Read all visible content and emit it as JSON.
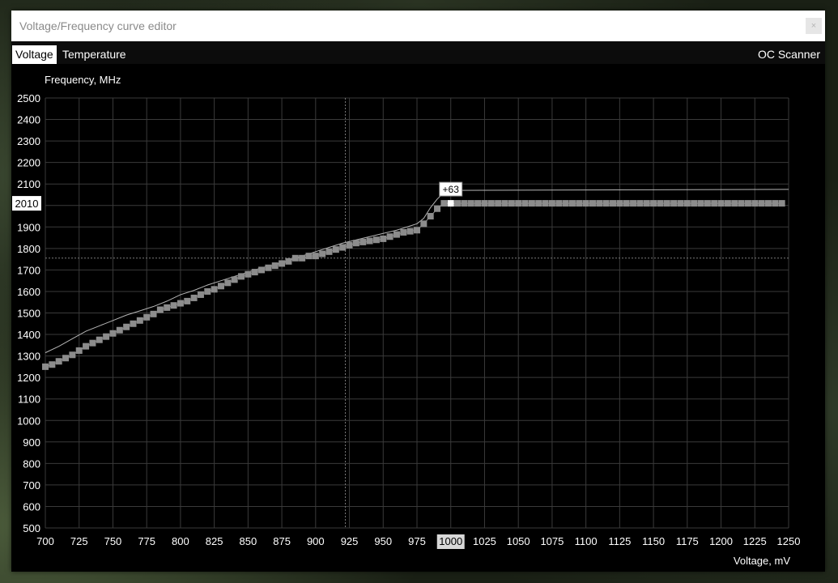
{
  "window": {
    "title": "Voltage/Frequency curve editor",
    "close_label": "×"
  },
  "tabs": [
    {
      "label": "Voltage",
      "active": true
    },
    {
      "label": "Temperature",
      "active": false
    }
  ],
  "oc_scanner_label": "OC Scanner",
  "chart_data": {
    "type": "line",
    "ylabel": "Frequency, MHz",
    "xlabel": "Voltage, mV",
    "xlim": [
      700,
      1250
    ],
    "ylim": [
      500,
      2500
    ],
    "x_ticks": [
      700,
      725,
      750,
      775,
      800,
      825,
      850,
      875,
      900,
      925,
      950,
      975,
      1000,
      1025,
      1050,
      1075,
      1100,
      1125,
      1150,
      1175,
      1200,
      1225,
      1250
    ],
    "y_ticks": [
      500,
      600,
      700,
      800,
      900,
      1000,
      1100,
      1200,
      1300,
      1400,
      1500,
      1600,
      1700,
      1800,
      1900,
      2000,
      2100,
      2200,
      2300,
      2400,
      2500
    ],
    "highlight_x_label": "1000",
    "highlight_y_label": "2010",
    "offset_label": "+63",
    "crosshair": {
      "x": 922,
      "y": 1755
    },
    "grid": true,
    "series": [
      {
        "style": "thin-line",
        "x": [
          700,
          710,
          720,
          730,
          740,
          750,
          760,
          770,
          780,
          790,
          800,
          810,
          820,
          830,
          840,
          850,
          860,
          870,
          880,
          890,
          900,
          910,
          920,
          930,
          940,
          950,
          960,
          970,
          975,
          980,
          985,
          990,
          995,
          1000,
          1250
        ],
        "y": [
          1315,
          1345,
          1380,
          1415,
          1440,
          1465,
          1490,
          1510,
          1530,
          1555,
          1585,
          1605,
          1630,
          1650,
          1670,
          1690,
          1710,
          1725,
          1745,
          1765,
          1785,
          1805,
          1825,
          1840,
          1855,
          1870,
          1885,
          1905,
          1915,
          1940,
          1990,
          2030,
          2060,
          2070,
          2075
        ]
      },
      {
        "style": "square-markers",
        "x": [
          700,
          705,
          710,
          715,
          720,
          725,
          730,
          735,
          740,
          745,
          750,
          755,
          760,
          765,
          770,
          775,
          780,
          785,
          790,
          795,
          800,
          805,
          810,
          815,
          820,
          825,
          830,
          835,
          840,
          845,
          850,
          855,
          860,
          865,
          870,
          875,
          880,
          885,
          890,
          895,
          900,
          905,
          910,
          915,
          920,
          925,
          930,
          935,
          940,
          945,
          950,
          955,
          960,
          965,
          970,
          975,
          980,
          985,
          990,
          995,
          1000,
          1005,
          1010,
          1015,
          1020,
          1025,
          1030,
          1035,
          1040,
          1045,
          1050,
          1055,
          1060,
          1065,
          1070,
          1075,
          1080,
          1085,
          1090,
          1095,
          1100,
          1105,
          1110,
          1115,
          1120,
          1125,
          1130,
          1135,
          1140,
          1145,
          1150,
          1155,
          1160,
          1165,
          1170,
          1175,
          1180,
          1185,
          1190,
          1195,
          1200,
          1205,
          1210,
          1215,
          1220,
          1225,
          1230,
          1235,
          1240,
          1245
        ],
        "y": [
          1250,
          1260,
          1275,
          1290,
          1305,
          1325,
          1345,
          1360,
          1375,
          1390,
          1405,
          1420,
          1435,
          1450,
          1465,
          1480,
          1495,
          1515,
          1525,
          1535,
          1545,
          1555,
          1570,
          1585,
          1600,
          1610,
          1625,
          1640,
          1655,
          1670,
          1680,
          1690,
          1700,
          1710,
          1720,
          1730,
          1740,
          1755,
          1755,
          1765,
          1765,
          1775,
          1785,
          1795,
          1805,
          1815,
          1825,
          1830,
          1835,
          1840,
          1845,
          1855,
          1865,
          1875,
          1880,
          1885,
          1915,
          1950,
          1985,
          2010,
          2010,
          2010,
          2010,
          2010,
          2010,
          2010,
          2010,
          2010,
          2010,
          2010,
          2010,
          2010,
          2010,
          2010,
          2010,
          2010,
          2010,
          2010,
          2010,
          2010,
          2010,
          2010,
          2010,
          2010,
          2010,
          2010,
          2010,
          2010,
          2010,
          2010,
          2010,
          2010,
          2010,
          2010,
          2010,
          2010,
          2010,
          2010,
          2010,
          2010,
          2010,
          2010,
          2010,
          2010,
          2010,
          2010,
          2010,
          2010,
          2010,
          2010
        ]
      }
    ]
  }
}
